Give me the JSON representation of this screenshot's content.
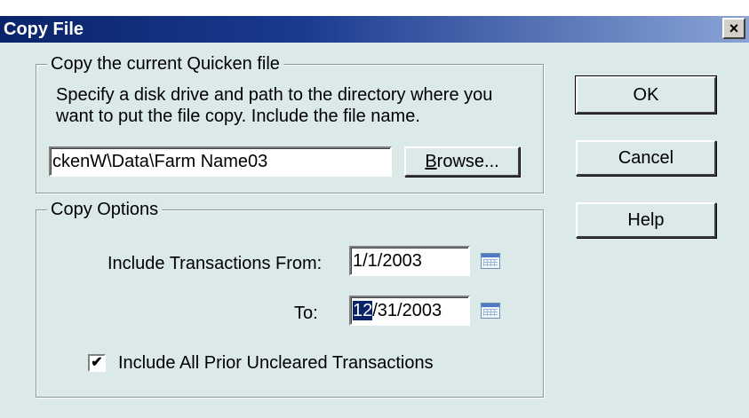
{
  "dialog": {
    "title": "Copy File",
    "close_label": "×"
  },
  "copy_group": {
    "legend": "Copy the current Quicken file",
    "instructions_line1": "Specify a disk drive and path to the directory where you",
    "instructions_line2": "want to put the file copy. Include the file name.",
    "path_value": "ckenW\\Data\\Farm Name03",
    "browse_label_mnemonic": "B",
    "browse_label_rest": "rowse..."
  },
  "options_group": {
    "legend": "Copy Options",
    "from_label": "Include Transactions From:",
    "from_value": "1/1/2003",
    "to_label": "To:",
    "to_value_selected": "12",
    "to_value_rest": "/31/2003",
    "checkbox_label": "Include All Prior Uncleared Transactions",
    "checkbox_checked": true
  },
  "buttons": {
    "ok": "OK",
    "cancel": "Cancel",
    "help": "Help"
  },
  "icons": {
    "calendar": "calendar-icon",
    "close": "close-icon",
    "check": "checkmark-icon"
  }
}
